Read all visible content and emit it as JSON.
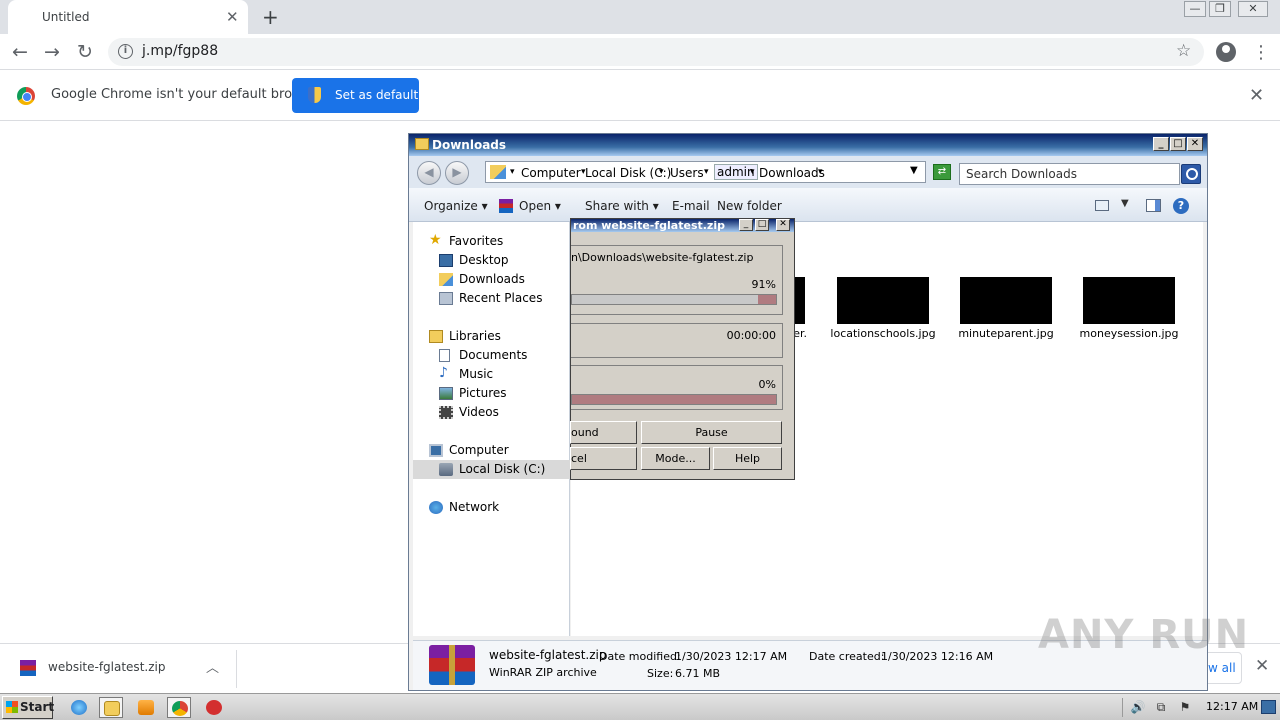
{
  "browser": {
    "tab_title": "Untitled",
    "tab_close": "✕",
    "new_tab": "+",
    "window_controls": [
      "—",
      "❐",
      "✕"
    ],
    "nav": {
      "back": "←",
      "forward": "→",
      "reload": "↻"
    },
    "url": "j.mp/fgp88",
    "info_glyph": "i",
    "star_glyph": "☆",
    "menu_glyph": "⋮",
    "infobar": {
      "message": "Google Chrome isn't your default browser",
      "button_label": "Set as default",
      "close": "✕"
    },
    "download_shelf": {
      "file_name": "website-fglatest.zip",
      "chevron": "︿",
      "show_all": "w all",
      "close": "✕"
    }
  },
  "explorer": {
    "title": "Downloads",
    "title_buttons": [
      "_",
      "□",
      "✕"
    ],
    "nav_back": "◀",
    "nav_forward": "▶",
    "breadcrumbs": [
      {
        "label": "Computer",
        "sep": "▾"
      },
      {
        "label": "Local Disk (C:)",
        "sep": "▾"
      },
      {
        "label": "Users",
        "sep": "▾"
      },
      {
        "label": "admin",
        "sep": "▾"
      },
      {
        "label": "Downloads",
        "sep": "▾"
      }
    ],
    "address_dropdown": "▼",
    "refresh_glyph": "⇄",
    "search_placeholder": "Search Downloads",
    "toolbar": {
      "organize": "Organize ▾",
      "open": "Open ▾",
      "share_with": "Share with ▾",
      "email": "E-mail",
      "new_folder": "New folder",
      "view_drop": "▼",
      "help": "?"
    },
    "nav_pane": {
      "favorites": "Favorites",
      "desktop": "Desktop",
      "downloads": "Downloads",
      "recent_places": "Recent Places",
      "libraries": "Libraries",
      "documents": "Documents",
      "music": "Music",
      "pictures": "Pictures",
      "videos": "Videos",
      "computer": "Computer",
      "local_disk": "Local Disk (C:)",
      "network": "Network"
    },
    "files": [
      {
        "name": "er."
      },
      {
        "name": "locationschools.jpg"
      },
      {
        "name": "minuteparent.jpg"
      },
      {
        "name": "moneysession.jpg"
      }
    ],
    "details": {
      "name": "website-fglatest.zip",
      "type": "WinRAR ZIP archive",
      "modified_label": "Date modified:",
      "modified": "1/30/2023 12:17 AM",
      "size_label": "Size:",
      "size": "6.71 MB",
      "created_label": "Date created:",
      "created": "1/30/2023 12:16 AM"
    }
  },
  "winrar_dialog": {
    "title": "rom website-fglatest.zip",
    "title_buttons": [
      "_",
      "□",
      "✕"
    ],
    "path": "n\\Downloads\\website-fglatest.zip",
    "file_progress_text": "91%",
    "file_progress": 0.91,
    "time": "00:00:00",
    "total_progress_text": "0%",
    "total_progress": 0.0,
    "buttons": {
      "background": "ound",
      "pause": "Pause",
      "cancel": "cel",
      "mode": "Mode...",
      "help": "Help"
    }
  },
  "watermark": "ANY RUN",
  "taskbar": {
    "start": "Start",
    "tray_icons": [
      "🔊",
      "⧉",
      "⚑"
    ],
    "clock": "12:17 AM"
  },
  "colors": {
    "chrome_blue": "#1a73e8",
    "progress_tail": "#b07b80",
    "xp_title": "#0a246a"
  }
}
